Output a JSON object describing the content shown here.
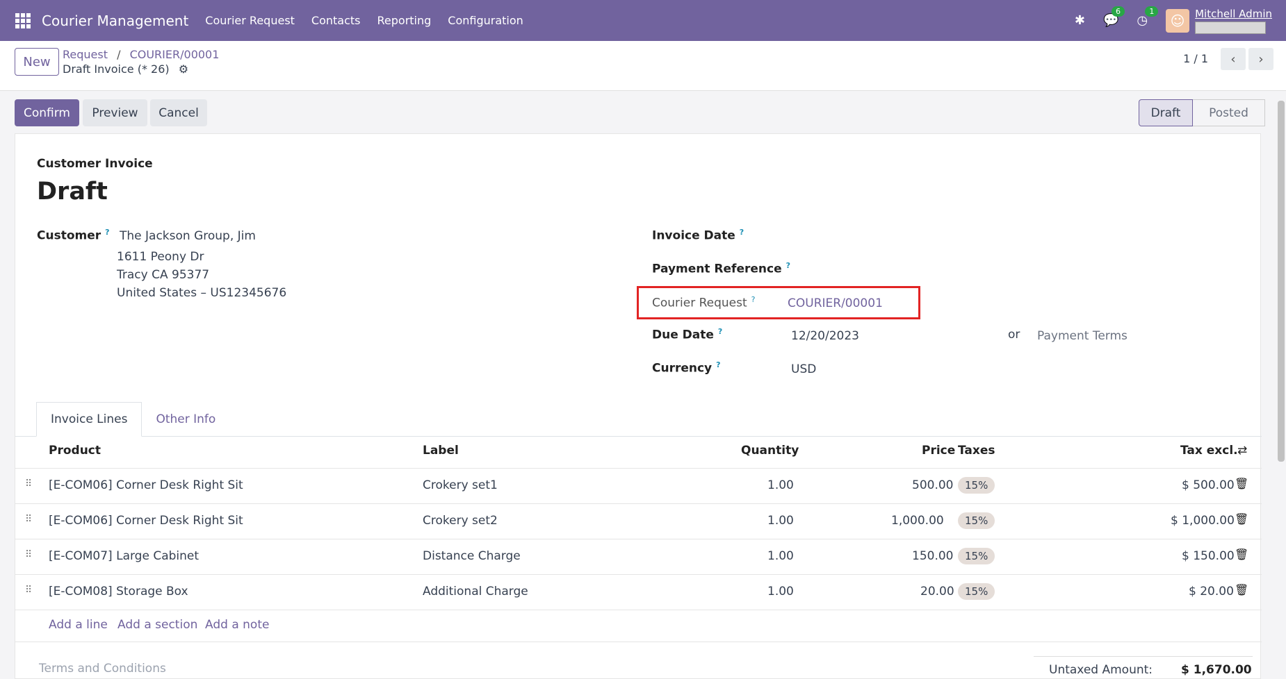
{
  "topbar": {
    "app_name": "Courier Management",
    "menu": [
      "Courier Request",
      "Contacts",
      "Reporting",
      "Configuration"
    ],
    "messages_count": "6",
    "activities_count": "1",
    "user_name": "Mitchell Admin",
    "bg_color": "#71639e"
  },
  "control_panel": {
    "new_label": "New",
    "breadcrumb_parent": "Request",
    "breadcrumb_sep": "/",
    "breadcrumb_current": "COURIER/00001",
    "record_name": "Draft Invoice (* 26)",
    "pager": "1 / 1"
  },
  "actions": {
    "confirm": "Confirm",
    "preview": "Preview",
    "cancel": "Cancel",
    "status_draft": "Draft",
    "status_posted": "Posted"
  },
  "invoice": {
    "subtitle": "Customer Invoice",
    "title": "Draft",
    "customer_label": "Customer",
    "customer_name": "The Jackson Group, Jim",
    "address_line1": "1611 Peony Dr",
    "address_line2": "Tracy CA 95377",
    "address_line3": "United States – US12345676",
    "invoice_date_label": "Invoice Date",
    "payment_reference_label": "Payment Reference",
    "courier_request_label": "Courier Request",
    "courier_request_value": "COURIER/00001",
    "due_date_label": "Due Date",
    "due_date_value": "12/20/2023",
    "or_label": "or",
    "payment_terms_placeholder": "Payment Terms",
    "currency_label": "Currency",
    "currency_value": "USD",
    "help_mark": "?"
  },
  "tabs": {
    "invoice_lines": "Invoice Lines",
    "other_info": "Other Info"
  },
  "table": {
    "headers": {
      "product": "Product",
      "label": "Label",
      "quantity": "Quantity",
      "price": "Price",
      "taxes": "Taxes",
      "tax_excl": "Tax excl."
    },
    "rows": [
      {
        "product": "[E-COM06] Corner Desk Right Sit",
        "label": "Crokery set1",
        "quantity": "1.00",
        "price": "500.00",
        "tax": "15%",
        "subtotal": "$ 500.00"
      },
      {
        "product": "[E-COM06] Corner Desk Right Sit",
        "label": "Crokery set2",
        "quantity": "1.00",
        "price": "1,000.00",
        "tax": "15%",
        "subtotal": "$ 1,000.00"
      },
      {
        "product": "[E-COM07] Large Cabinet",
        "label": "Distance Charge",
        "quantity": "1.00",
        "price": "150.00",
        "tax": "15%",
        "subtotal": "$ 150.00"
      },
      {
        "product": "[E-COM08] Storage Box",
        "label": "Additional Charge",
        "quantity": "1.00",
        "price": "20.00",
        "tax": "15%",
        "subtotal": "$ 20.00"
      }
    ],
    "add_line": "Add a line",
    "add_section": "Add a section",
    "add_note": "Add a note"
  },
  "footer": {
    "terms_placeholder": "Terms and Conditions",
    "untaxed_label": "Untaxed Amount:",
    "untaxed_value": "$ 1,670.00"
  }
}
